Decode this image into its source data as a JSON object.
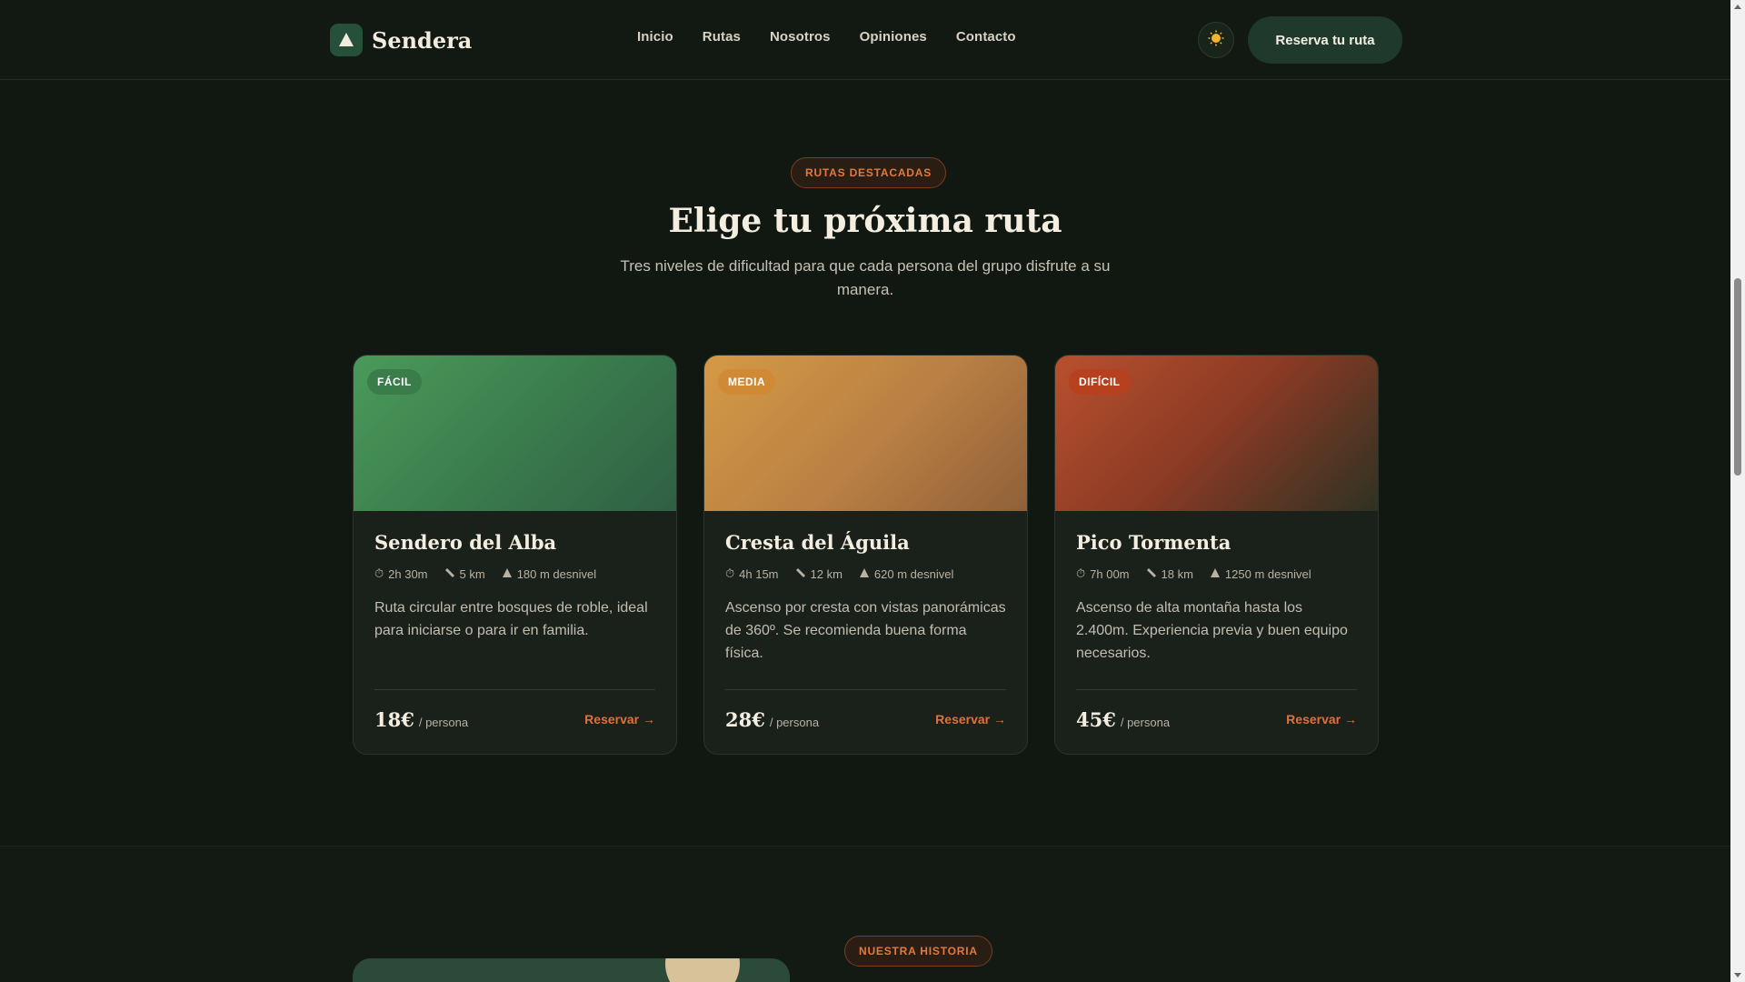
{
  "header": {
    "brand_name": "Sendera",
    "brand_icon": "mountain-icon",
    "nav": [
      {
        "label": "Inicio"
      },
      {
        "label": "Rutas"
      },
      {
        "label": "Nosotros"
      },
      {
        "label": "Opiniones"
      },
      {
        "label": "Contacto"
      }
    ],
    "theme_icon": "sun-icon",
    "cta_label": "Reserva tu ruta"
  },
  "featured": {
    "pill": "RUTAS DESTACADAS",
    "title": "Elige tu próxima ruta",
    "subtitle": "Tres niveles de dificultad para que cada persona del grupo disfrute a su manera.",
    "cards": [
      {
        "badge": "FÁCIL",
        "title": "Sendero del Alba",
        "time": "2h 30m",
        "distance": "5 km",
        "elevation": "180 m desnivel",
        "description": "Ruta circular entre bosques de roble, ideal para iniciarse o para ir en familia.",
        "price": "18€",
        "price_unit": "/ persona",
        "reserve": "Reservar →"
      },
      {
        "badge": "MEDIA",
        "title": "Cresta del Águila",
        "time": "4h 15m",
        "distance": "12 km",
        "elevation": "620 m desnivel",
        "description": "Ascenso por cresta con vistas panorámicas de 360º. Se recomienda buena forma física.",
        "price": "28€",
        "price_unit": "/ persona",
        "reserve": "Reservar →"
      },
      {
        "badge": "DIFÍCIL",
        "title": "Pico Tormenta",
        "time": "7h 00m",
        "distance": "18 km",
        "elevation": "1250 m desnivel",
        "description": "Ascenso de alta montaña hasta los 2.400m. Experiencia previa y buen equipo necesarios.",
        "price": "45€",
        "price_unit": "/ persona",
        "reserve": "Reservar →"
      }
    ]
  },
  "story": {
    "pill": "NUESTRA HISTORIA"
  },
  "colors": {
    "accent": "#e0703a",
    "background": "#111811",
    "brand_green": "#27503a"
  }
}
